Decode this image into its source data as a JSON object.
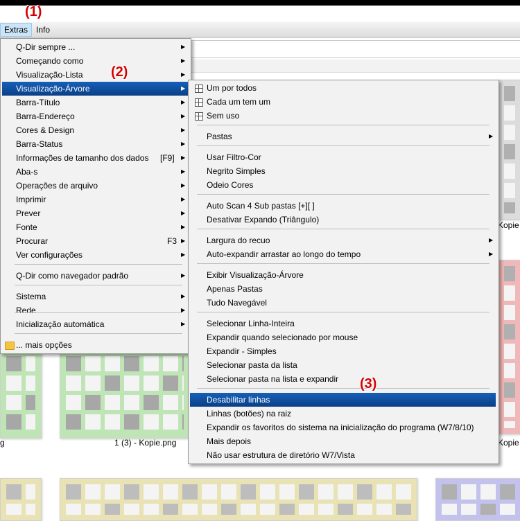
{
  "menubar": {
    "items": [
      "Extras",
      "Info"
    ]
  },
  "annotations": {
    "a1": "(1)",
    "a2": "(2)",
    "a3": "(3)"
  },
  "background": {
    "captions": {
      "c1": "Kopie",
      "c2": "1 (3) - Kopie.png",
      "c3": "Kopie",
      "c4": "g"
    }
  },
  "extras_menu": {
    "items": [
      {
        "label": "Q-Dir sempre ...",
        "submenu": true
      },
      {
        "label": "Começando como",
        "submenu": true
      },
      {
        "label": "Visualização-Lista",
        "submenu": true
      },
      {
        "label": "Visualização-Árvore",
        "submenu": true,
        "highlighted": true
      },
      {
        "label": "Barra-Título",
        "submenu": true
      },
      {
        "label": "Barra-Endereço",
        "submenu": true
      },
      {
        "label": "Cores & Design",
        "submenu": true
      },
      {
        "label": "Barra-Status",
        "submenu": true
      },
      {
        "label": "Informações de tamanho dos dados",
        "shortcut": "[F9]",
        "submenu": true
      },
      {
        "label": "Aba-s",
        "submenu": true
      },
      {
        "label": "Operações de arquivo",
        "submenu": true
      },
      {
        "label": "Imprimir",
        "submenu": true
      },
      {
        "label": "Prever",
        "submenu": true
      },
      {
        "label": "Fonte",
        "submenu": true
      },
      {
        "label": "Procurar",
        "shortcut": "F3",
        "submenu": true
      },
      {
        "label": "Ver configurações",
        "submenu": true
      },
      {
        "label": "Q-Dir como navegador padrão",
        "submenu": true
      },
      {
        "label": "Sistema",
        "submenu": true
      },
      {
        "label": "Rede",
        "submenu": true
      },
      {
        "label": "Inicialização automática",
        "submenu": true
      },
      {
        "label": "... mais opções",
        "submenu": false,
        "icon": "folder-icon"
      }
    ]
  },
  "tree_menu": {
    "items": [
      {
        "label": "Um por todos",
        "icon": "tree-icon"
      },
      {
        "label": "Cada um tem um",
        "icon": "tree-icon"
      },
      {
        "label": "Sem uso",
        "icon": "tree-icon"
      },
      {
        "label": "Pastas",
        "submenu": true
      },
      {
        "label": "Usar Filtro-Cor"
      },
      {
        "label": "Negrito Simples"
      },
      {
        "label": "Odeio Cores"
      },
      {
        "label": "Auto Scan 4 Sub pastas [+][ ]"
      },
      {
        "label": "Desativar Expando (Triângulo)"
      },
      {
        "label": "Largura do recuo",
        "submenu": true
      },
      {
        "label": "Auto-expandir arrastar ao longo do tempo",
        "submenu": true
      },
      {
        "label": "Exibir Visualização-Árvore"
      },
      {
        "label": "Apenas Pastas"
      },
      {
        "label": "Tudo Navegável"
      },
      {
        "label": "Selecionar Linha-Inteira"
      },
      {
        "label": "Expandir quando selecionado por mouse"
      },
      {
        "label": "Expandir - Simples"
      },
      {
        "label": "Selecionar pasta da lista"
      },
      {
        "label": "Selecionar pasta na lista e expandir"
      },
      {
        "label": "Desabilitar linhas",
        "highlighted": true
      },
      {
        "label": "Linhas (botões) na raiz"
      },
      {
        "label": "Expandir os favoritos do sistema na inicialização do programa (W7/8/10)"
      },
      {
        "label": "Mais depois"
      },
      {
        "label": "Não usar estrutura de diretório W7/Vista"
      }
    ]
  },
  "colors": {
    "highlight": "#0b4f9e",
    "menu_bg": "#f2f2f2",
    "annotation": "#d40000"
  }
}
